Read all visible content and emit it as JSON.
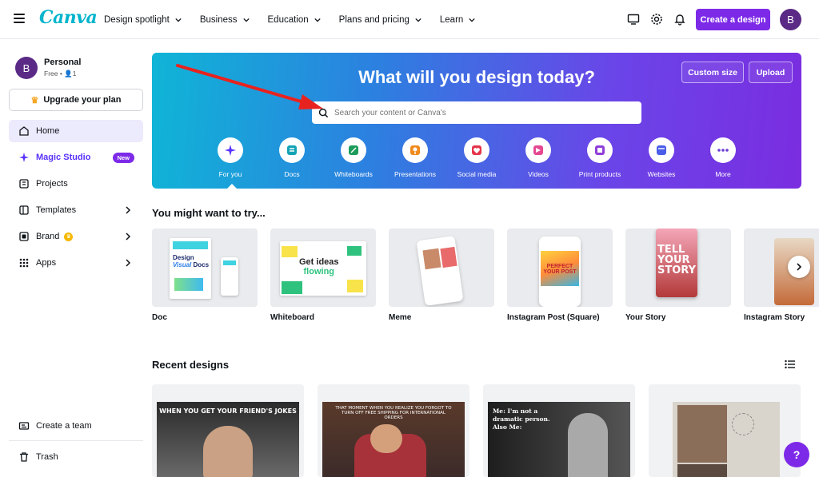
{
  "app": {
    "logo": "Canva"
  },
  "nav": [
    {
      "label": "Design spotlight"
    },
    {
      "label": "Business"
    },
    {
      "label": "Education"
    },
    {
      "label": "Plans and pricing"
    },
    {
      "label": "Learn"
    }
  ],
  "header": {
    "create_label": "Create a design",
    "avatar_initial": "B"
  },
  "account": {
    "initial": "B",
    "name": "Personal",
    "sub": "Free • 👤1"
  },
  "sidebar": {
    "upgrade_label": "Upgrade your plan",
    "items": [
      {
        "label": "Home"
      },
      {
        "label": "Magic Studio",
        "badge": "New"
      },
      {
        "label": "Projects"
      },
      {
        "label": "Templates"
      },
      {
        "label": "Brand"
      },
      {
        "label": "Apps"
      }
    ],
    "create_team": "Create a team",
    "trash": "Trash"
  },
  "hero": {
    "title": "What will you design today?",
    "custom_size": "Custom size",
    "upload": "Upload",
    "search_placeholder": "Search your content or Canva's",
    "categories": [
      {
        "label": "For you"
      },
      {
        "label": "Docs"
      },
      {
        "label": "Whiteboards"
      },
      {
        "label": "Presentations"
      },
      {
        "label": "Social media"
      },
      {
        "label": "Videos"
      },
      {
        "label": "Print products"
      },
      {
        "label": "Websites"
      },
      {
        "label": "More"
      }
    ]
  },
  "suggestions": {
    "title": "You might want to try...",
    "items": [
      {
        "label": "Doc"
      },
      {
        "label": "Whiteboard"
      },
      {
        "label": "Meme"
      },
      {
        "label": "Instagram Post (Square)"
      },
      {
        "label": "Your Story"
      },
      {
        "label": "Instagram Story"
      }
    ]
  },
  "recent": {
    "title": "Recent designs",
    "items": [
      {
        "caption": "WHEN YOU GET YOUR FRIEND'S JOKES"
      },
      {
        "caption": "THAT MOMENT WHEN YOU REALIZE YOU FORGOT TO TURN OFF FREE SHIPPING FOR INTERNATIONAL ORDERS"
      },
      {
        "caption": "Me: I'm not a dramatic person. Also Me:"
      },
      {
        "caption": ""
      }
    ]
  },
  "help": {
    "label": "?"
  },
  "colors": {
    "accent": "#7d2ae8",
    "logo": "#00b4cc",
    "arrow": "#e8231f"
  }
}
